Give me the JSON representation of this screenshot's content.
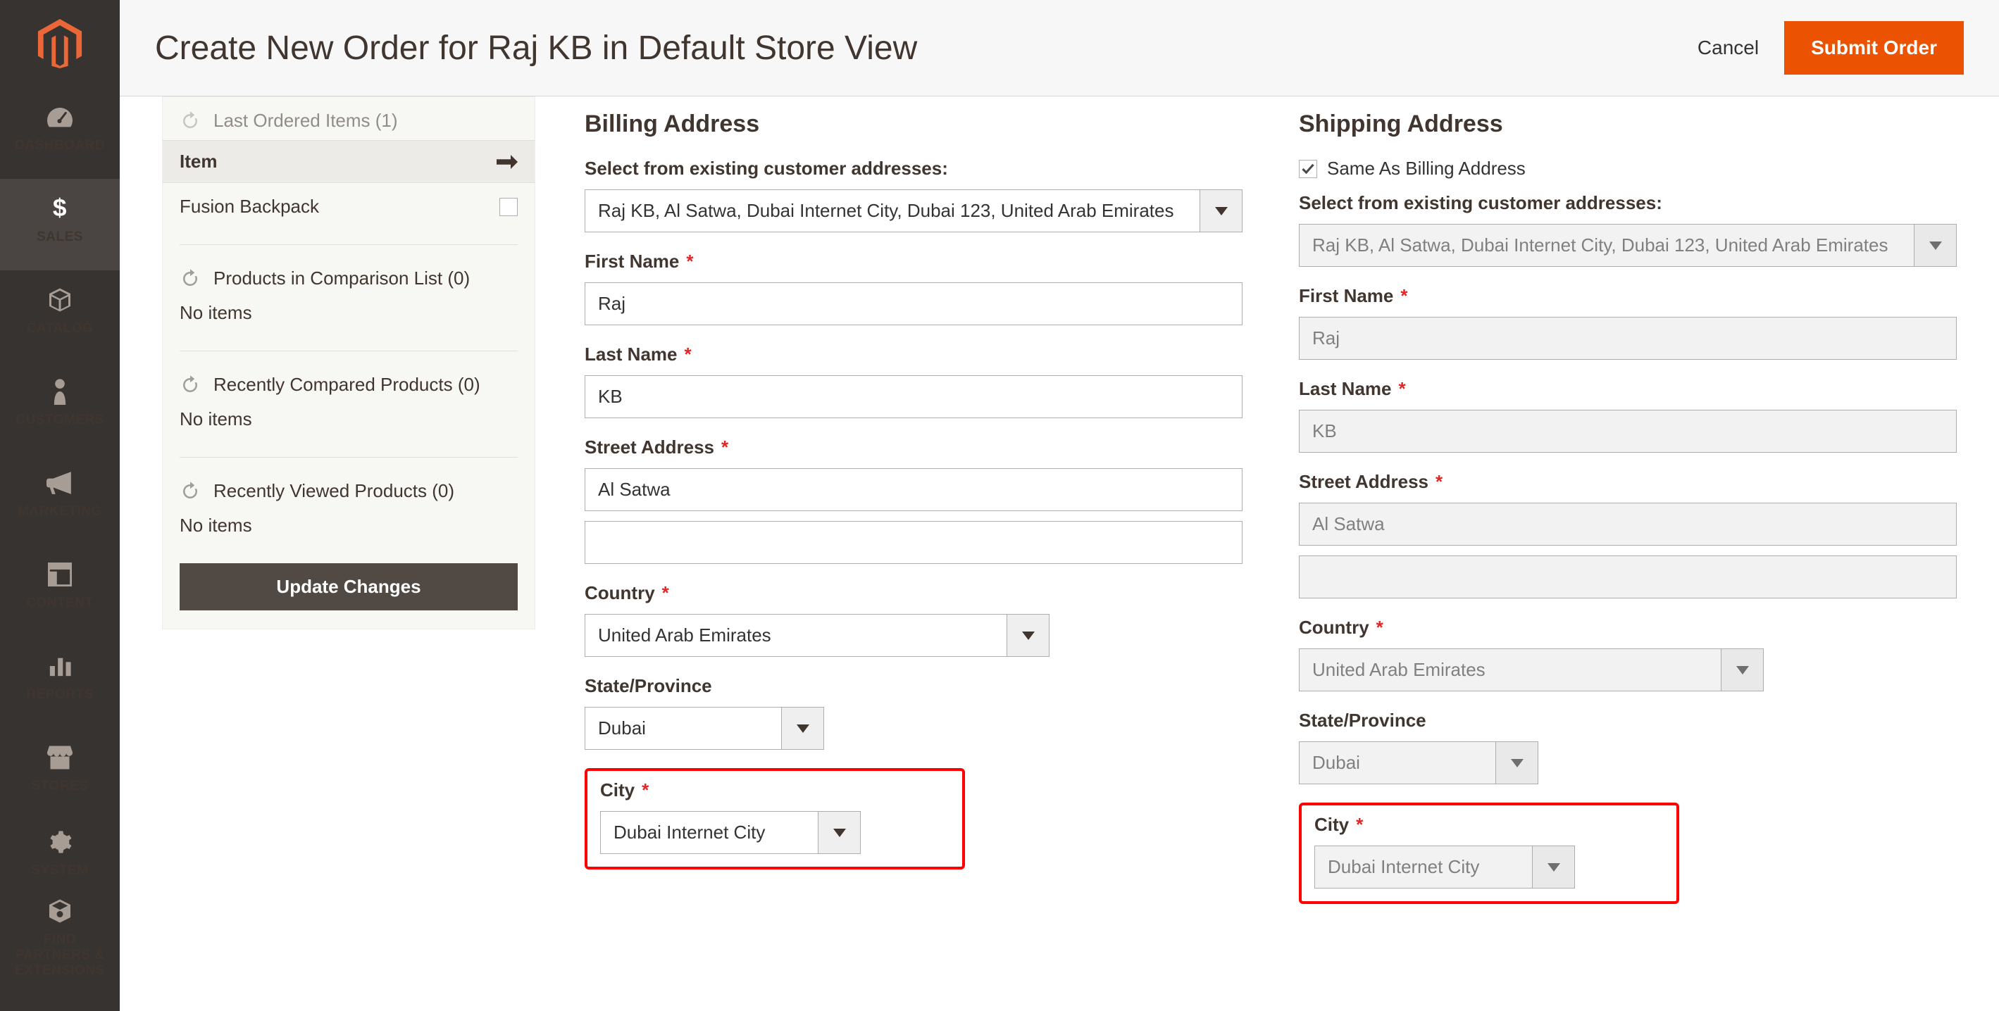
{
  "header": {
    "title": "Create New Order for Raj KB in Default Store View",
    "cancel_label": "Cancel",
    "submit_label": "Submit Order"
  },
  "nav": {
    "dashboard": "DASHBOARD",
    "sales": "SALES",
    "catalog": "CATALOG",
    "customers": "CUSTOMERS",
    "marketing": "MARKETING",
    "content": "CONTENT",
    "reports": "REPORTS",
    "stores": "STORES",
    "system": "SYSTEM",
    "partners": "FIND PARTNERS & EXTENSIONS"
  },
  "sidepanel": {
    "last_ordered_label": "Last Ordered Items (1)",
    "item_header": "Item",
    "items": [
      {
        "name": "Fusion Backpack"
      }
    ],
    "comparison_label": "Products in Comparison List (0)",
    "no_items": "No items",
    "recently_compared_label": "Recently Compared Products (0)",
    "recently_viewed_label": "Recently Viewed Products (0)",
    "update_label": "Update Changes"
  },
  "billing": {
    "heading": "Billing Address",
    "select_label": "Select from existing customer addresses:",
    "selected_address": "Raj KB, Al Satwa, Dubai Internet City, Dubai 123, United Arab Emirates",
    "first_name_label": "First Name",
    "first_name": "Raj",
    "last_name_label": "Last Name",
    "last_name": "KB",
    "street_label": "Street Address",
    "street1": "Al Satwa",
    "street2": "",
    "country_label": "Country",
    "country": "United Arab Emirates",
    "state_label": "State/Province",
    "state": "Dubai",
    "city_label": "City",
    "city": "Dubai Internet City"
  },
  "shipping": {
    "heading": "Shipping Address",
    "same_as_label": "Same As Billing Address",
    "select_label": "Select from existing customer addresses:",
    "selected_address": "Raj KB, Al Satwa, Dubai Internet City, Dubai 123, United Arab Emirates",
    "first_name_label": "First Name",
    "first_name": "Raj",
    "last_name_label": "Last Name",
    "last_name": "KB",
    "street_label": "Street Address",
    "street1": "Al Satwa",
    "street2": "",
    "country_label": "Country",
    "country": "United Arab Emirates",
    "state_label": "State/Province",
    "state": "Dubai",
    "city_label": "City",
    "city": "Dubai Internet City"
  }
}
